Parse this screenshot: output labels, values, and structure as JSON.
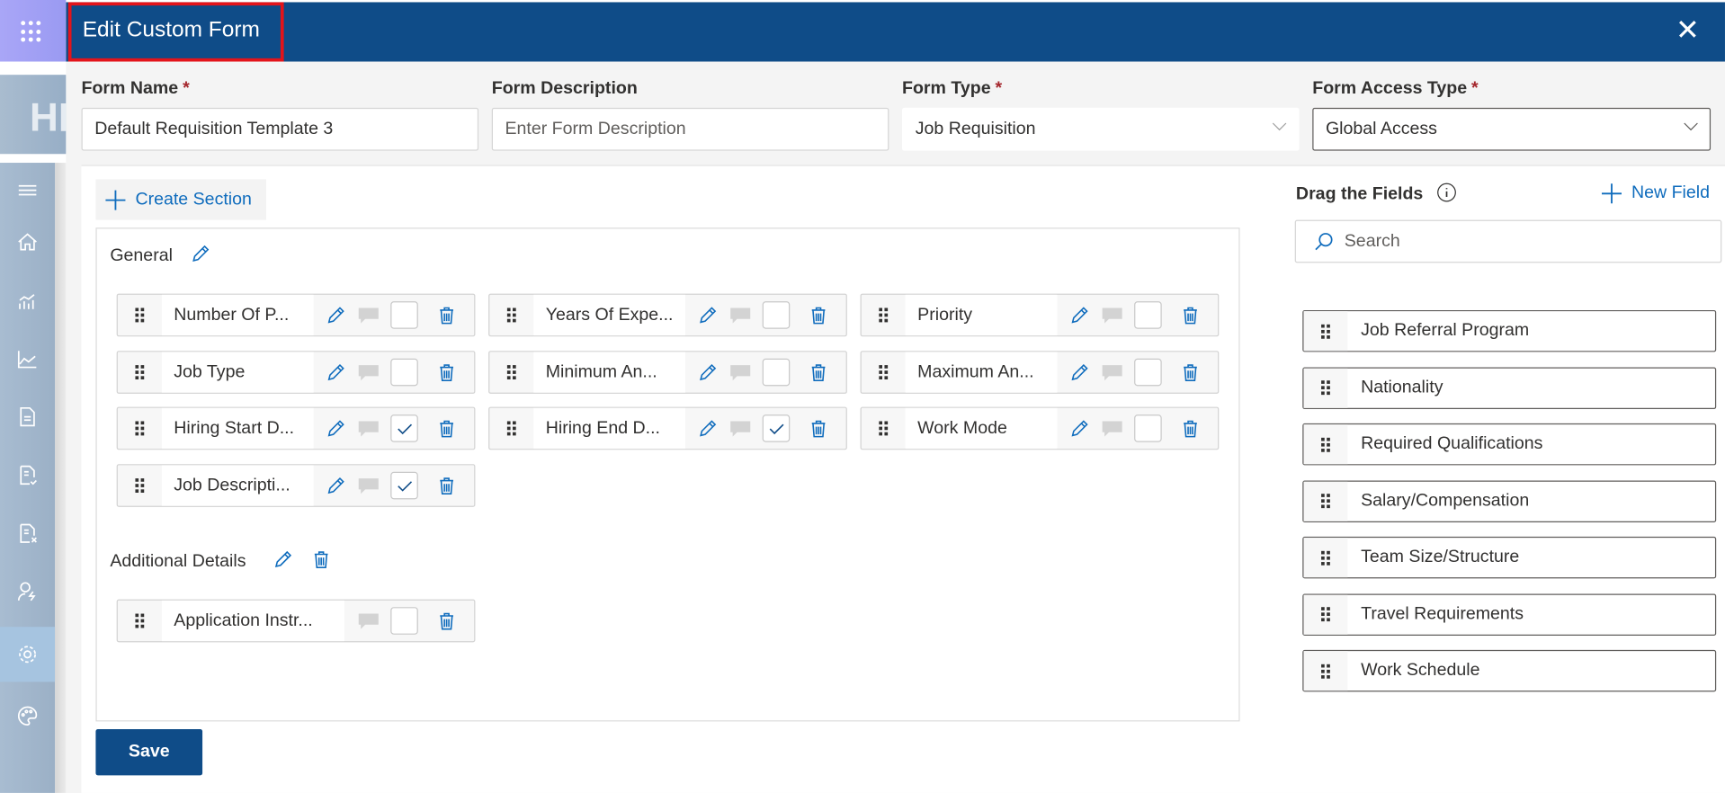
{
  "app": {
    "logo_text": "HR",
    "nav_items": [
      "menu",
      "home",
      "analytics",
      "trend",
      "document",
      "document-check",
      "document-remove",
      "user-flash",
      "settings",
      "palette"
    ],
    "active_nav": "settings"
  },
  "modal": {
    "title": "Edit Custom Form",
    "close_icon": "close-icon",
    "fields": {
      "form_name": {
        "label": "Form Name",
        "required": "*",
        "value": "Default Requisition Template 3"
      },
      "form_description": {
        "label": "Form Description",
        "placeholder": "Enter Form Description"
      },
      "form_type": {
        "label": "Form Type",
        "required": "*",
        "value": "Job Requisition"
      },
      "form_access_type": {
        "label": "Form Access Type",
        "required": "*",
        "value": "Global Access"
      }
    },
    "create_section_label": "Create Section",
    "sections": [
      {
        "title": "General",
        "fields": [
          {
            "label": "Number Of P...",
            "checked": false,
            "editable": true
          },
          {
            "label": "Years Of Expe...",
            "checked": false,
            "editable": true
          },
          {
            "label": "Priority",
            "checked": false,
            "editable": true
          },
          {
            "label": "Job Type",
            "checked": false,
            "editable": true
          },
          {
            "label": "Minimum An...",
            "checked": false,
            "editable": true
          },
          {
            "label": "Maximum An...",
            "checked": false,
            "editable": true
          },
          {
            "label": "Hiring Start D...",
            "checked": true,
            "editable": true
          },
          {
            "label": "Hiring End D...",
            "checked": true,
            "editable": true
          },
          {
            "label": "Work Mode",
            "checked": false,
            "editable": true
          },
          {
            "label": "Job Descripti...",
            "checked": true,
            "editable": true
          }
        ]
      },
      {
        "title": "Additional Details",
        "fields": [
          {
            "label": "Application Instr...",
            "checked": false,
            "editable": false
          }
        ]
      }
    ],
    "save_label": "Save",
    "right_panel": {
      "title": "Drag the Fields",
      "new_field_label": "New Field",
      "search_placeholder": "Search",
      "items": [
        "Job Referral Program",
        "Nationality",
        "Required Qualifications",
        "Salary/Compensation",
        "Team Size/Structure",
        "Travel Requirements",
        "Work Schedule"
      ]
    },
    "colors": {
      "header": "#0f4c88",
      "accent": "#0f6cbd",
      "highlight_border": "#e3141b"
    }
  }
}
